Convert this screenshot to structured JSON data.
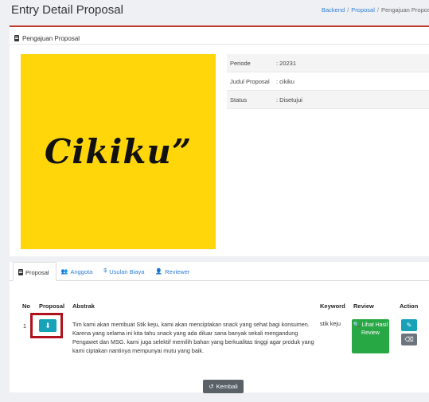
{
  "page": {
    "title": "Entry Detail Proposal",
    "breadcrumb": [
      "Backend",
      "Proposal",
      "Pengajuan Propos"
    ]
  },
  "panel": {
    "title": "Pengajuan Proposal",
    "poster_text": "Cikiku”",
    "info": [
      {
        "label": "Periode",
        "value": ": 20231"
      },
      {
        "label": "Judul Proposal",
        "value": ": cikiku"
      },
      {
        "label": "Status",
        "value": ": Disetujui"
      }
    ]
  },
  "tabs": [
    {
      "label": "Proposal",
      "icon": "doc-icon",
      "active": true
    },
    {
      "label": "Anggota",
      "icon": "users-icon",
      "active": false
    },
    {
      "label": "Usulan Biaya",
      "icon": "dollar-icon",
      "active": false
    },
    {
      "label": "Reviewer",
      "icon": "user-plus-icon",
      "active": false
    }
  ],
  "table": {
    "headers": [
      "No",
      "Proposal",
      "Abstrak",
      "Keyword",
      "Review",
      "Action"
    ],
    "row": {
      "no": "1",
      "abstract": "Tim kami akan membuat Stik keju, kami akan menciptakan snack yang sehat bagi konsumen. Karena yang selama ini kita tahu snack yang ada diluar sana banyak sekali mengandung Pengawet dan MSG. kami juga selektif memilih bahan yang berkualitas tinggi agar produk yang kami ciptakan nantinya mempunyai mutu yang baik.",
      "keyword": "stik keju",
      "review_label": "Lihat Hasil Review"
    }
  },
  "footer": {
    "back_label": "Kembali"
  },
  "colors": {
    "accent": "#c0392b",
    "info": "#17a2b8",
    "success": "#28a745",
    "poster_bg": "#ffd60a",
    "highlight": "#b0121b"
  }
}
